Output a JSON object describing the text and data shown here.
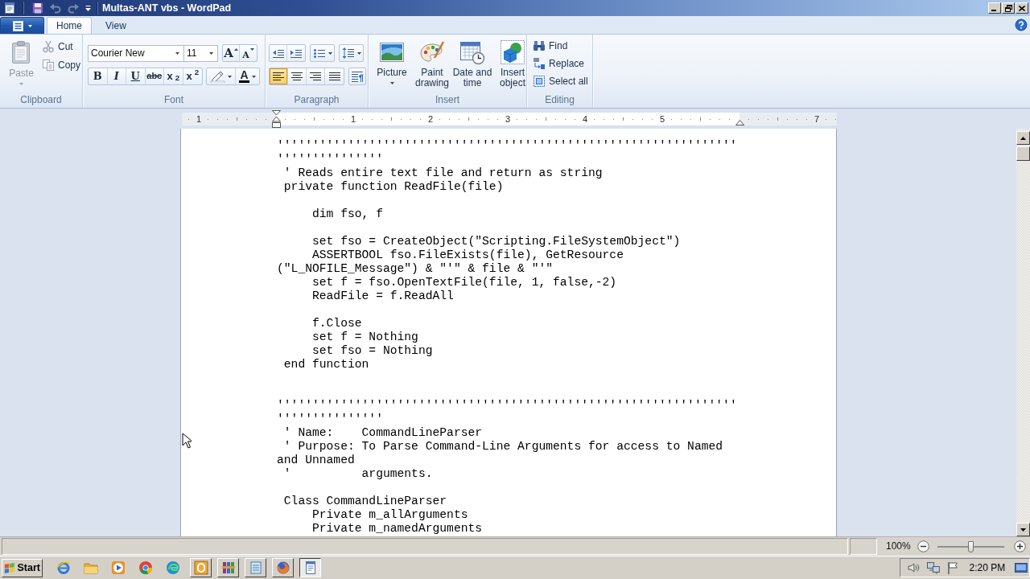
{
  "window": {
    "title": "Multas-ANT vbs - WordPad"
  },
  "quick_access": [
    {
      "disabled": false
    },
    {
      "disabled": true
    },
    {
      "disabled": true
    }
  ],
  "tabs": [
    {
      "label": "Home",
      "selected": true
    },
    {
      "label": "View",
      "selected": false
    }
  ],
  "ribbon": {
    "clipboard": {
      "label": "Clipboard",
      "paste": {
        "label": "Paste",
        "disabled": true
      },
      "items": [
        {
          "label": "Cut",
          "disabled": true
        },
        {
          "label": "Copy",
          "disabled": true
        }
      ]
    },
    "font": {
      "label": "Font",
      "font_name": "Courier New",
      "font_size": "11",
      "size_buttons": [
        {
          "kind": "grow",
          "label": "A"
        },
        {
          "kind": "shrink",
          "label": "A"
        }
      ],
      "format_buttons": [
        {
          "kind": "bold",
          "label": "B"
        },
        {
          "kind": "italic",
          "label": "I"
        },
        {
          "kind": "underline",
          "label": "U"
        },
        {
          "kind": "strike",
          "label": "abc"
        },
        {
          "kind": "subscript",
          "label": "x$_{2}$"
        },
        {
          "kind": "superscript",
          "label": "x$^{2}$"
        }
      ],
      "font_color": {
        "label": "A"
      }
    },
    "paragraph": {
      "label": "Paragraph",
      "align_buttons": [
        {
          "selected": true
        },
        {
          "selected": false
        },
        {
          "selected": false
        },
        {
          "selected": false
        }
      ]
    },
    "insert": {
      "label": "Insert",
      "items": [
        {
          "label": "Picture",
          "dropdown": true
        },
        {
          "label": "Paint drawing",
          "dropdown": false
        },
        {
          "label": "Date and time",
          "dropdown": false
        },
        {
          "label": "Insert object",
          "dropdown": false
        }
      ]
    },
    "editing": {
      "label": "Editing",
      "items": [
        {
          "label": "Find"
        },
        {
          "label": "Replace"
        },
        {
          "label": "Select all"
        }
      ]
    }
  },
  "ruler": {
    "marks": [
      {
        "kind": "number",
        "text": "1"
      },
      {
        "kind": "left-indent"
      },
      {
        "kind": "number",
        "text": "1"
      },
      {
        "kind": "number",
        "text": "2"
      },
      {
        "kind": "number",
        "text": "3"
      },
      {
        "kind": "number",
        "text": "4"
      },
      {
        "kind": "number",
        "text": "5"
      },
      {
        "kind": "right-indent"
      },
      {
        "kind": "number",
        "text": "7"
      }
    ]
  },
  "document": {
    "lines": [
      {
        "kind": "code",
        "text": "'''''''''''''''''''''''''''''''''''''''''''''''''''''''''''''''''"
      },
      {
        "kind": "code",
        "text": "'''''''''''''''"
      },
      {
        "kind": "code",
        "text": " ' Reads entire text file and return as string"
      },
      {
        "kind": "code",
        "text": " private function ReadFile(file)"
      },
      {
        "kind": "blank"
      },
      {
        "kind": "code",
        "text": "     dim fso, f"
      },
      {
        "kind": "blank"
      },
      {
        "kind": "code",
        "text": "     set fso = CreateObject(\"Scripting.FileSystemObject\")"
      },
      {
        "kind": "code",
        "text": "     ASSERTBOOL fso.FileExists(file), GetResource"
      },
      {
        "kind": "code",
        "text": "(\"L_NOFILE_Message\") & \"'\" & file & \"'\""
      },
      {
        "kind": "code",
        "text": "     set f = fso.OpenTextFile(file, 1, false,-2)"
      },
      {
        "kind": "code",
        "text": "     ReadFile = f.ReadAll"
      },
      {
        "kind": "blank"
      },
      {
        "kind": "code",
        "text": "     f.Close"
      },
      {
        "kind": "code",
        "text": "     set f = Nothing"
      },
      {
        "kind": "code",
        "text": "     set fso = Nothing"
      },
      {
        "kind": "code",
        "text": " end function"
      },
      {
        "kind": "blank"
      },
      {
        "kind": "blank"
      },
      {
        "kind": "code",
        "text": "'''''''''''''''''''''''''''''''''''''''''''''''''''''''''''''''''"
      },
      {
        "kind": "code",
        "text": "'''''''''''''''"
      },
      {
        "kind": "code",
        "text": " ' Name:    CommandLineParser"
      },
      {
        "kind": "code",
        "text": " ' Purpose: To Parse Command-Line Arguments for access to Named"
      },
      {
        "kind": "code",
        "text": "and Unnamed"
      },
      {
        "kind": "code",
        "text": " '          arguments."
      },
      {
        "kind": "blank"
      },
      {
        "kind": "code",
        "text": " Class CommandLineParser"
      },
      {
        "kind": "code",
        "text": "     Private m_allArguments"
      },
      {
        "kind": "code",
        "text": "     Private m_namedArguments"
      }
    ]
  },
  "status_bar": {
    "zoom": "100%",
    "zoom_slider": {
      "level": 0.5
    }
  },
  "taskbar": {
    "start": "Start",
    "tasks": [
      {
        "selected": false
      },
      {
        "selected": false
      },
      {
        "selected": false
      },
      {
        "selected": false
      },
      {
        "selected": true
      }
    ],
    "clock": "2:20 PM"
  }
}
